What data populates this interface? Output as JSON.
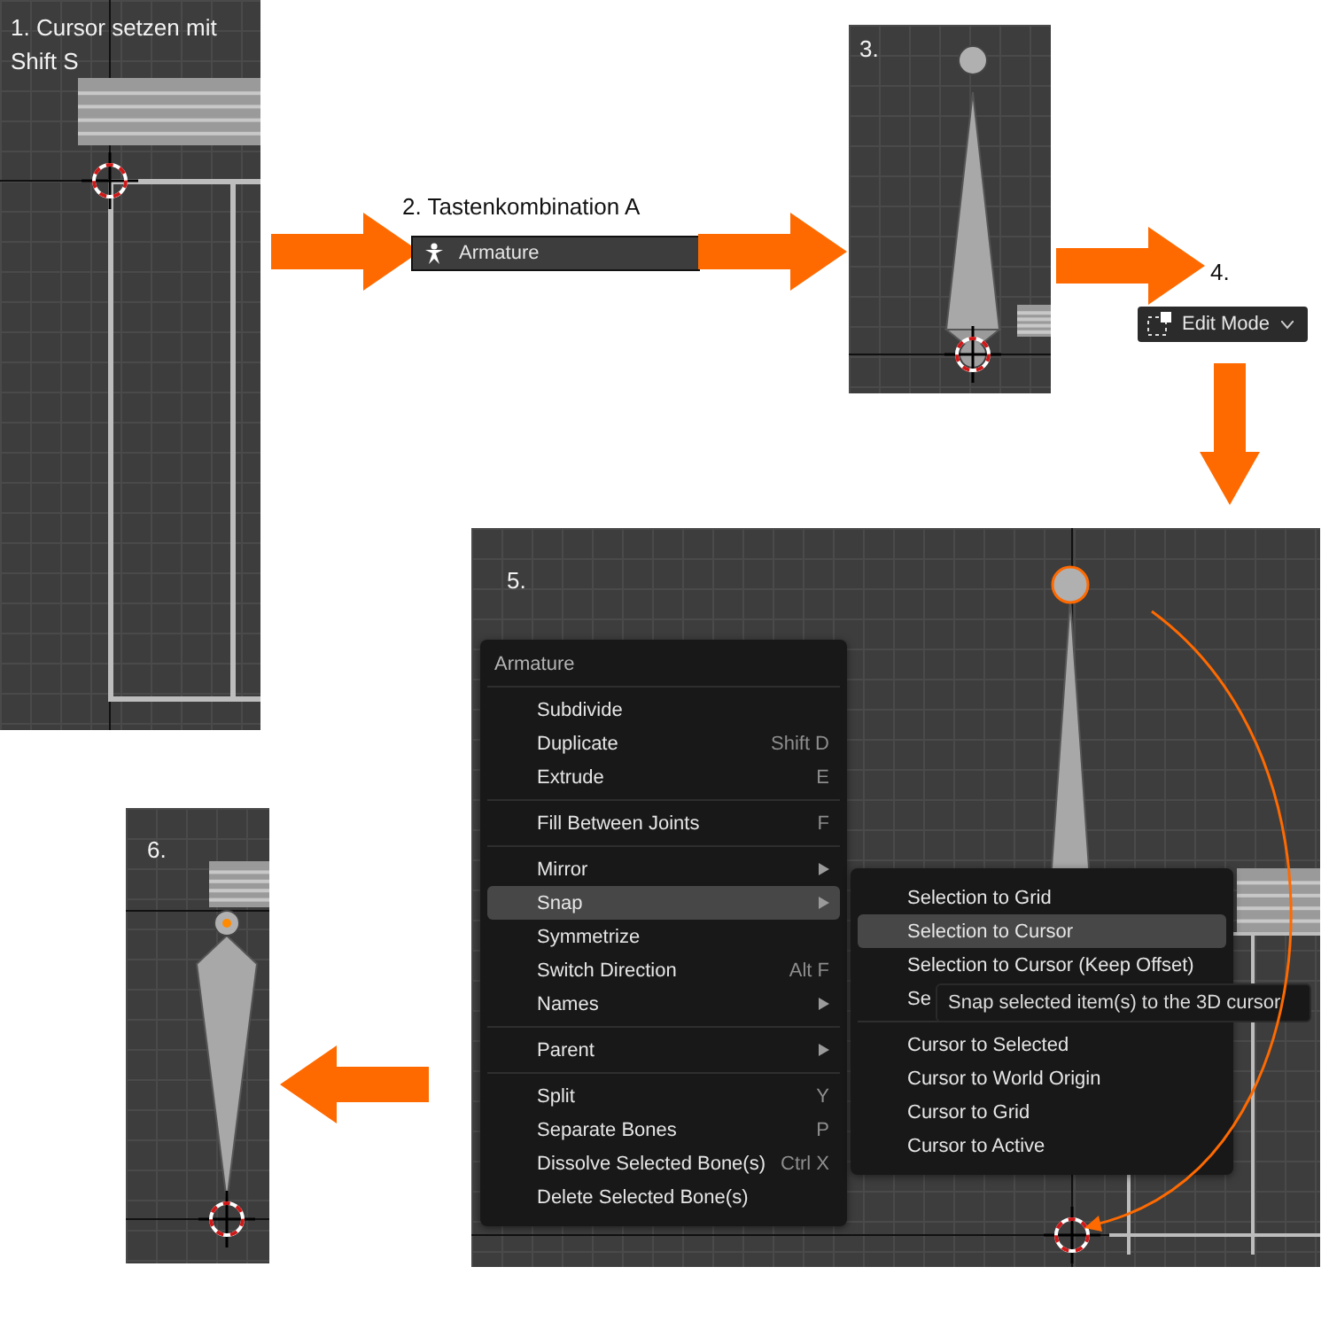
{
  "step1": {
    "label": "1. Cursor setzen mit Shift S"
  },
  "step2": {
    "label": "2.  Tastenkombination A",
    "menu_item": "Armature"
  },
  "step3": {
    "label": "3."
  },
  "step4": {
    "label": "4.",
    "mode_selector": "Edit Mode"
  },
  "step5": {
    "label": "5.",
    "menu": {
      "title": "Armature",
      "sections": [
        [
          {
            "label": "Subdivide",
            "submenu": false,
            "selected": false
          },
          {
            "label": "Duplicate",
            "shortcut": "Shift D",
            "submenu": false,
            "selected": false
          },
          {
            "label": "Extrude",
            "shortcut": "E",
            "submenu": false,
            "selected": false
          }
        ],
        [
          {
            "label": "Fill Between Joints",
            "shortcut": "F",
            "submenu": false,
            "selected": false
          }
        ],
        [
          {
            "label": "Mirror",
            "submenu": true,
            "selected": false
          },
          {
            "label": "Snap",
            "submenu": true,
            "selected": true
          },
          {
            "label": "Symmetrize",
            "submenu": false,
            "selected": false
          },
          {
            "label": "Switch Direction",
            "shortcut": "Alt F",
            "submenu": false,
            "selected": false
          },
          {
            "label": "Names",
            "submenu": true,
            "selected": false
          }
        ],
        [
          {
            "label": "Parent",
            "submenu": true,
            "selected": false
          }
        ],
        [
          {
            "label": "Split",
            "shortcut": "Y",
            "submenu": false,
            "selected": false
          },
          {
            "label": "Separate Bones",
            "shortcut": "P",
            "submenu": false,
            "selected": false
          },
          {
            "label": "Dissolve Selected Bone(s)",
            "shortcut": "Ctrl X",
            "submenu": false,
            "selected": false
          },
          {
            "label": "Delete Selected Bone(s)",
            "submenu": false,
            "selected": false
          }
        ]
      ]
    },
    "submenu": {
      "sections": [
        [
          {
            "label": "Selection to Grid",
            "selected": false
          },
          {
            "label": "Selection to Cursor",
            "selected": true
          },
          {
            "label": "Selection to Cursor (Keep Offset)",
            "selected": false
          },
          {
            "label": "Se",
            "selected": false
          }
        ],
        [
          {
            "label": "Cursor to Selected",
            "selected": false
          },
          {
            "label": "Cursor to World Origin",
            "selected": false
          },
          {
            "label": "Cursor to Grid",
            "selected": false
          },
          {
            "label": "Cursor to Active",
            "selected": false
          }
        ]
      ]
    },
    "tooltip": "Snap selected item(s) to the 3D cursor"
  },
  "step6": {
    "label": "6."
  }
}
